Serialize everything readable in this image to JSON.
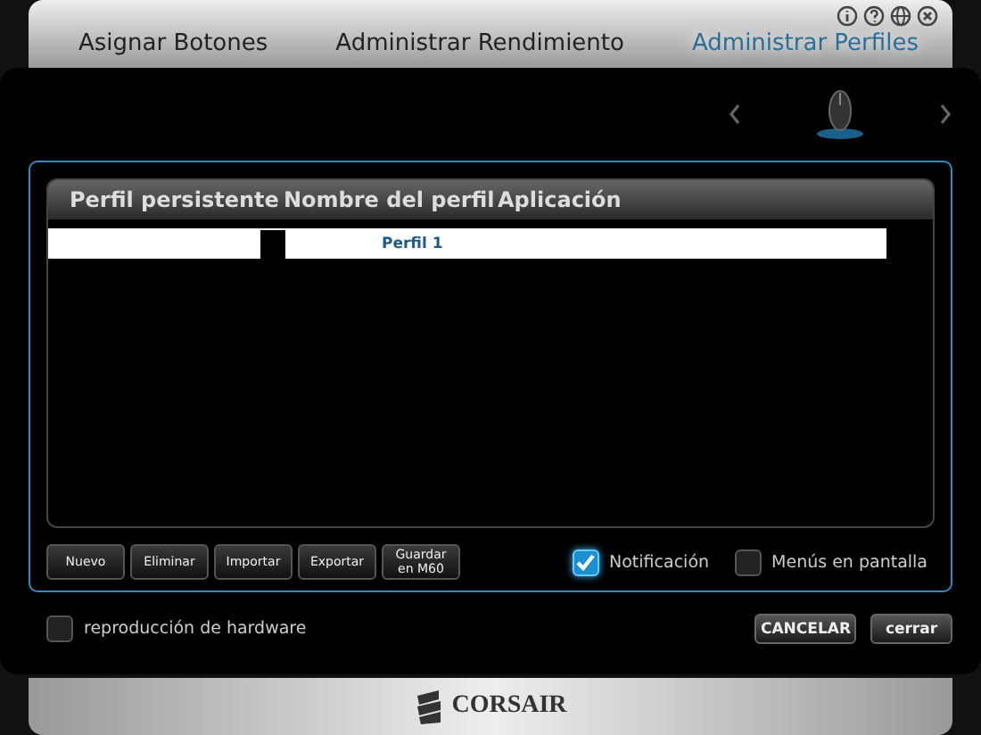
{
  "tabs": [
    {
      "label": "Asignar Botones",
      "selected": false
    },
    {
      "label": "Administrar Rendimiento",
      "selected": false
    },
    {
      "label": "Administrar Perfiles",
      "selected": true
    }
  ],
  "window_icons": [
    {
      "kind": "info"
    },
    {
      "kind": "help"
    },
    {
      "kind": "globe"
    },
    {
      "kind": "close"
    }
  ],
  "table": {
    "columns": [
      "Perfil persistente",
      "Nombre del perfil",
      "Aplicación"
    ],
    "rows": [
      {
        "persistent": false,
        "name": "Perfil 1",
        "selected": true
      }
    ]
  },
  "buttons": [
    {
      "label": "Nuevo"
    },
    {
      "label": "Eliminar"
    },
    {
      "label": "Importar"
    },
    {
      "label": "Exportar"
    },
    {
      "label": "Guardar en M60"
    }
  ],
  "options": [
    {
      "label": "Notificación",
      "checked": true
    },
    {
      "label": "Menús en pantalla",
      "checked": false
    }
  ],
  "hardware_playback": {
    "label": "reproducción de hardware",
    "checked": false
  },
  "dialog_buttons": [
    {
      "label": "CANCELAR"
    },
    {
      "label": "cerrar"
    }
  ],
  "footer": {
    "logo": "CORSAIR"
  }
}
